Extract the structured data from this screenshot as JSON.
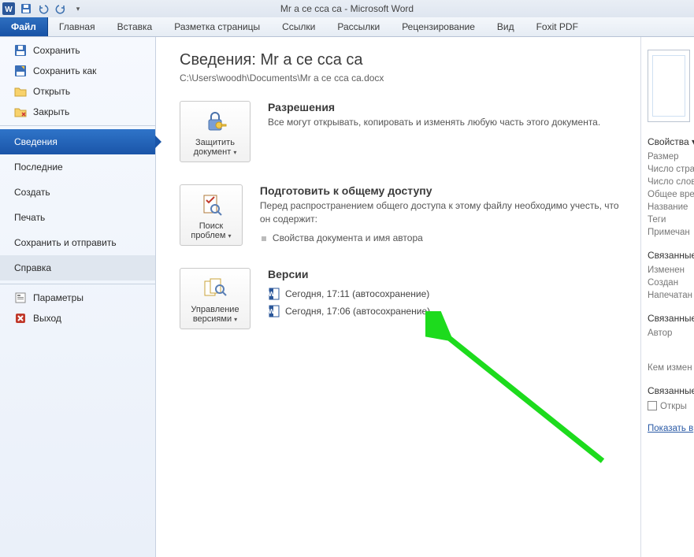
{
  "titlebar": {
    "title": "Mr a ce  cca ca  -  Microsoft Word"
  },
  "ribbon": {
    "file": "Файл",
    "tabs": [
      "Главная",
      "Вставка",
      "Разметка страницы",
      "Ссылки",
      "Рассылки",
      "Рецензирование",
      "Вид",
      "Foxit PDF"
    ]
  },
  "leftnav": {
    "cmds_top": [
      "Сохранить",
      "Сохранить как",
      "Открыть",
      "Закрыть"
    ],
    "items": [
      "Сведения",
      "Последние",
      "Создать",
      "Печать",
      "Сохранить и отправить",
      "Справка"
    ],
    "cmds_bottom": [
      "Параметры",
      "Выход"
    ]
  },
  "center": {
    "heading": "Сведения: Mr a ce  cca ca",
    "path": "C:\\Users\\woodh\\Documents\\Mr a ce  cca ca.docx",
    "sec1": {
      "btn1": "Защитить",
      "btn2": "документ",
      "title": "Разрешения",
      "text": "Все могут открывать, копировать и изменять любую часть этого документа."
    },
    "sec2": {
      "btn1": "Поиск",
      "btn2": "проблем",
      "title": "Подготовить к общему доступу",
      "text": "Перед распространением общего доступа к этому файлу необходимо учесть, что он содержит:",
      "bullet": "Свойства документа и имя автора"
    },
    "sec3": {
      "btn1": "Управление",
      "btn2": "версиями",
      "title": "Версии",
      "versions": [
        "Сегодня, 17:11 (автосохранение)",
        "Сегодня, 17:06 (автосохранение)"
      ]
    }
  },
  "right": {
    "hdr1": "Свойства ▾",
    "props1": [
      "Размер",
      "Число стра",
      "Число слов",
      "Общее вре",
      "Название",
      "Теги",
      "Примечан"
    ],
    "hdr2": "Связанные",
    "props2": [
      "Изменен",
      "Создан",
      "Напечатан"
    ],
    "hdr3": "Связанные",
    "props3": [
      "Автор"
    ],
    "who": "Кем измен",
    "hdr4": "Связанные",
    "open": "Откры",
    "showall": "Показать в"
  }
}
